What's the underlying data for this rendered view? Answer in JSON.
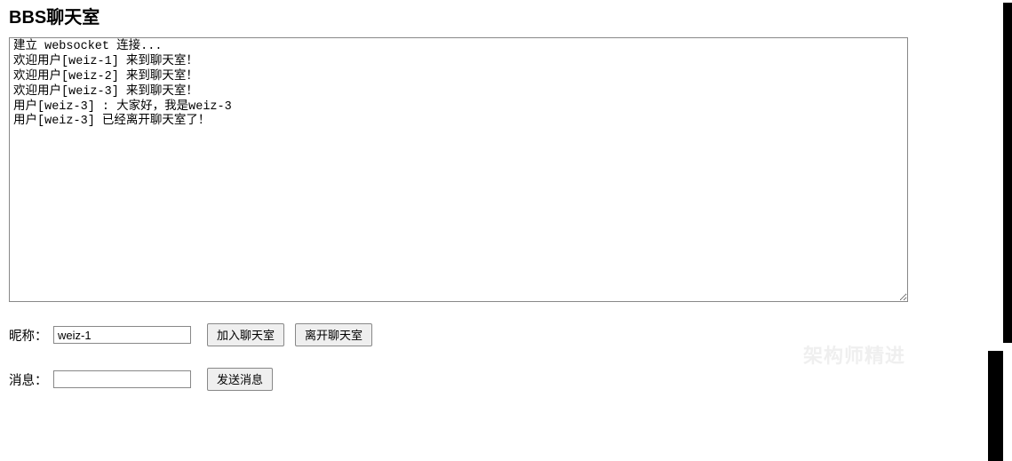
{
  "title": "BBS聊天室",
  "log": "建立 websocket 连接...\n欢迎用户[weiz-1] 来到聊天室！\n欢迎用户[weiz-2] 来到聊天室！\n欢迎用户[weiz-3] 来到聊天室！\n用户[weiz-3] : 大家好，我是weiz-3\n用户[weiz-3] 已经离开聊天室了！",
  "nickname": {
    "label": "昵称：",
    "value": "weiz-1"
  },
  "message": {
    "label": "消息：",
    "value": ""
  },
  "buttons": {
    "join": "加入聊天室",
    "leave": "离开聊天室",
    "send": "发送消息"
  },
  "watermark": "架构师精进"
}
